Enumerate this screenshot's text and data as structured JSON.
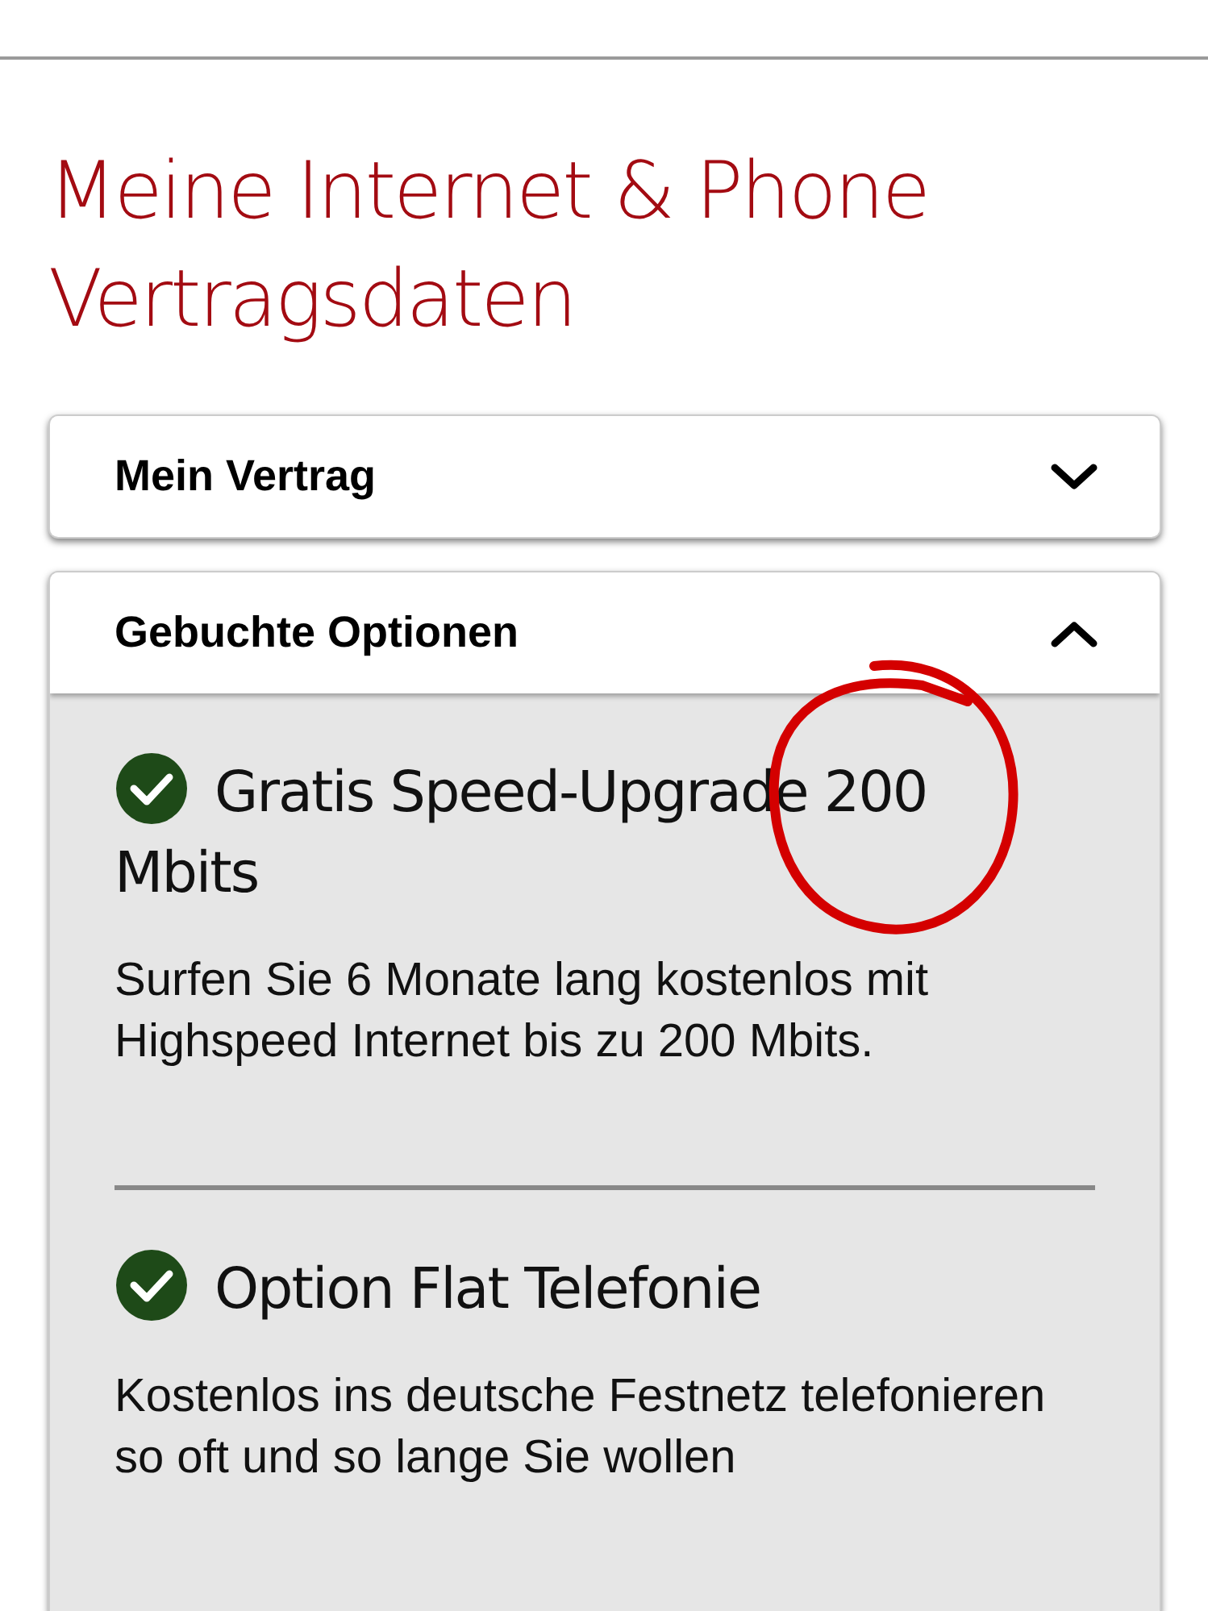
{
  "heading": "Meine Internet & Phone Vertragsdaten",
  "sections": [
    {
      "title": "Mein Vertrag",
      "expanded": false
    },
    {
      "title": "Gebuchte Optionen",
      "expanded": true,
      "options": [
        {
          "title": "Gratis Speed-Upgrade 200 Mbits",
          "description": "Surfen Sie 6 Monate lang kostenlos mit Highspeed Internet bis zu 200 Mbits."
        },
        {
          "title": "Option Flat Telefonie",
          "description": "Kostenlos ins deutsche Festnetz telefonieren so oft und so lange Sie wollen"
        }
      ]
    }
  ]
}
